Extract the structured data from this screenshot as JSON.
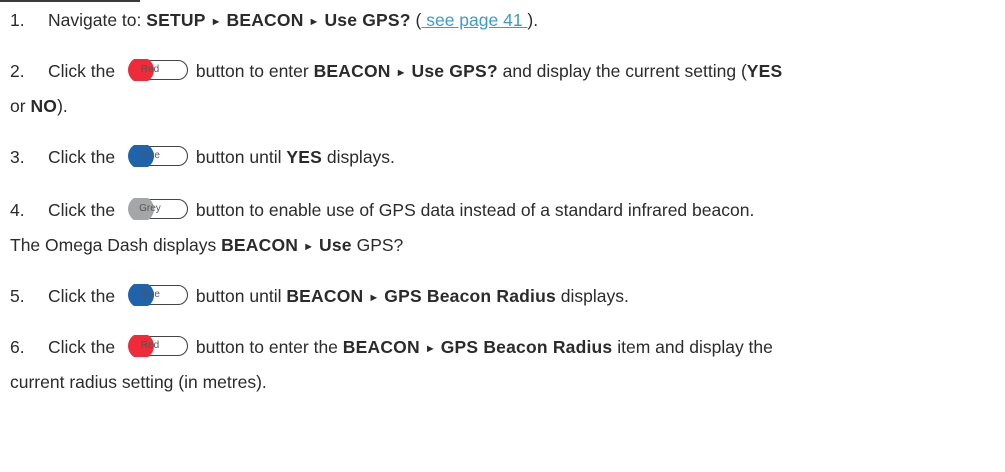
{
  "steps": [
    {
      "num": "1.",
      "text_a": "Navigate to: ",
      "path_1": "SETUP",
      "path_2": "BEACON",
      "path_3": "Use GPS?",
      "text_b": " (",
      "link": " see page 41 ",
      "text_c": ")."
    },
    {
      "num": "2.",
      "text_a": "Click the",
      "button": "Red",
      "text_b": "button to enter ",
      "path_1": "BEACON",
      "path_2": "Use GPS?",
      "text_c": " and display the current setting (",
      "opt_yes": "YES",
      "line2_a": "or ",
      "opt_no": "NO",
      "line2_b": ")."
    },
    {
      "num": "3.",
      "text_a": "Click the",
      "button": "Blue",
      "text_b": "button until ",
      "opt_yes": "YES",
      "text_c": " displays."
    },
    {
      "num": "4.",
      "text_a": "Click the",
      "button": "Grey",
      "text_b": "button to enable use of GPS data instead of a standard infrared beacon.",
      "line2_a": "The Omega Dash displays ",
      "path_1": "BEACON",
      "path_2": "Use",
      "line2_b": " GPS?"
    },
    {
      "num": "5.",
      "text_a": "Click the",
      "button": "Blue",
      "text_b": "button until ",
      "path_1": "BEACON",
      "path_2": "GPS Beacon Radius",
      "text_c": " displays."
    },
    {
      "num": "6.",
      "text_a": "Click the",
      "button": "Red",
      "text_b": "button to enter the ",
      "path_1": "BEACON",
      "path_2": "GPS Beacon Radius",
      "text_c": " item and display the",
      "line2_a": "current radius setting (in metres)."
    }
  ],
  "colors": {
    "red": "#ef2b3a",
    "blue": "#1f63ad",
    "grey": "#a4a6a8",
    "link": "#3b9ad6"
  },
  "icons": {
    "arrow": "triangle-right-icon"
  }
}
